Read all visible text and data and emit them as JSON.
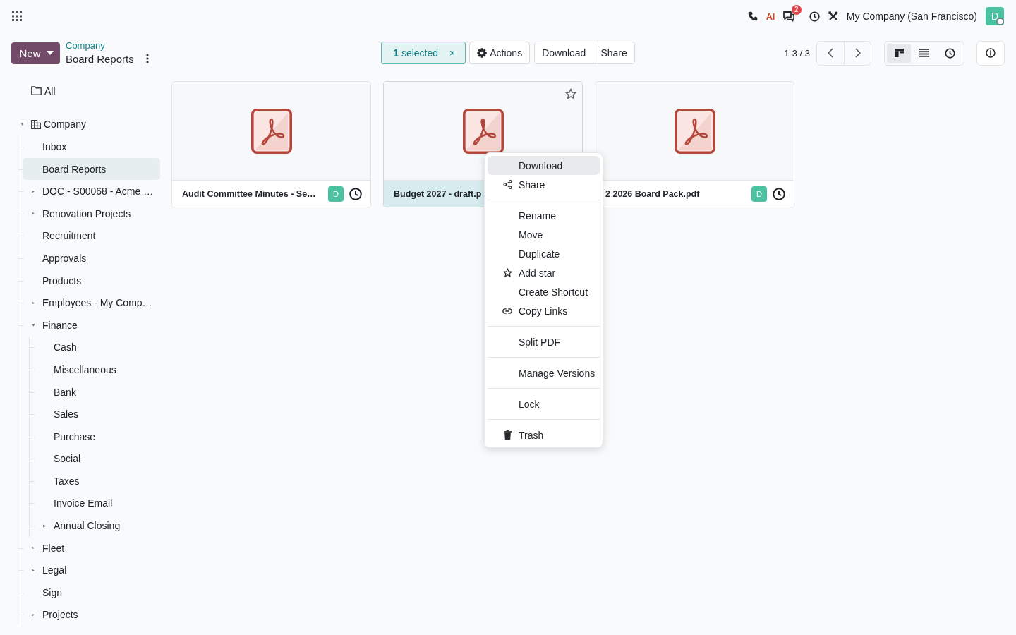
{
  "navbar": {
    "ai_label": "AI",
    "message_count": "2",
    "company": "My Company (San Francisco)",
    "avatar": "D"
  },
  "control_panel": {
    "new_button": "New",
    "breadcrumb_parent": "Company",
    "breadcrumb_current": "Board Reports",
    "selection": "**1** selected",
    "clear_selection": "×",
    "actions_button": "Actions",
    "buttons": [
      "Download",
      "Share"
    ],
    "pager": "1-3 / 3",
    "views": [
      {
        "kind": "kanban",
        "selected": true
      },
      {
        "kind": "list",
        "selected": false
      },
      {
        "kind": "activity",
        "selected": false
      }
    ]
  },
  "sidebar": {
    "all": {
      "label": "All",
      "selected": false
    },
    "tree": [
      {
        "label": "Company",
        "expanded": true,
        "selected": false,
        "children": [
          {
            "label": "Inbox",
            "selected": false
          },
          {
            "label": "Board Reports",
            "selected": true
          },
          {
            "label": "DOC - S00068 - Acme …",
            "expanded": false,
            "selected": false
          },
          {
            "label": "Renovation Projects",
            "expanded": false,
            "selected": false
          },
          {
            "label": "Recruitment",
            "selected": false
          },
          {
            "label": "Approvals",
            "selected": false
          },
          {
            "label": "Products",
            "selected": false
          },
          {
            "label": "Employees - My Comp…",
            "expanded": false,
            "selected": false
          },
          {
            "label": "Finance",
            "expanded": true,
            "selected": false,
            "children": [
              {
                "label": "Cash",
                "selected": false
              },
              {
                "label": "Miscellaneous",
                "selected": false
              },
              {
                "label": "Bank",
                "selected": false
              },
              {
                "label": "Sales",
                "selected": false
              },
              {
                "label": "Purchase",
                "selected": false
              },
              {
                "label": "Social",
                "selected": false
              },
              {
                "label": "Taxes",
                "selected": false
              },
              {
                "label": "Invoice Email",
                "selected": false
              },
              {
                "label": "Annual Closing",
                "expanded": false,
                "selected": false
              }
            ]
          },
          {
            "label": "Fleet",
            "expanded": false,
            "selected": false
          },
          {
            "label": "Legal",
            "expanded": false,
            "selected": false
          },
          {
            "label": "Sign",
            "selected": false
          },
          {
            "label": "Projects",
            "expanded": false,
            "selected": false
          }
        ]
      }
    ]
  },
  "cards": [
    {
      "name": "Audit Committee Minutes - Se…",
      "selected": false,
      "hovered": false,
      "avatar": "D"
    },
    {
      "name": "Budget 2027 - draft.p",
      "selected": true,
      "hovered": true
    },
    {
      "name": "2 2026 Board Pack.pdf",
      "selected": false,
      "hovered": false,
      "avatar": "D"
    }
  ],
  "context_menu": {
    "groups": [
      [
        {
          "label": "Download",
          "kind": "plain",
          "selected": true
        },
        {
          "label": "Share",
          "kind": "share",
          "selected": false
        }
      ],
      [
        {
          "label": "Rename",
          "kind": "plain",
          "selected": false
        },
        {
          "label": "Move",
          "kind": "plain",
          "selected": false
        },
        {
          "label": "Duplicate",
          "kind": "plain",
          "selected": false
        },
        {
          "label": "Add star",
          "kind": "star",
          "selected": false
        },
        {
          "label": "Create Shortcut",
          "kind": "plain",
          "selected": false
        },
        {
          "label": "Copy Links",
          "kind": "link",
          "selected": false
        }
      ],
      [
        {
          "label": "Split PDF",
          "kind": "plain",
          "selected": false
        }
      ],
      [
        {
          "label": "Manage Versions",
          "kind": "plain",
          "selected": false
        }
      ],
      [
        {
          "label": "Lock",
          "kind": "plain",
          "selected": false
        }
      ],
      [
        {
          "label": "Trash",
          "kind": "trash",
          "selected": false
        }
      ]
    ]
  }
}
